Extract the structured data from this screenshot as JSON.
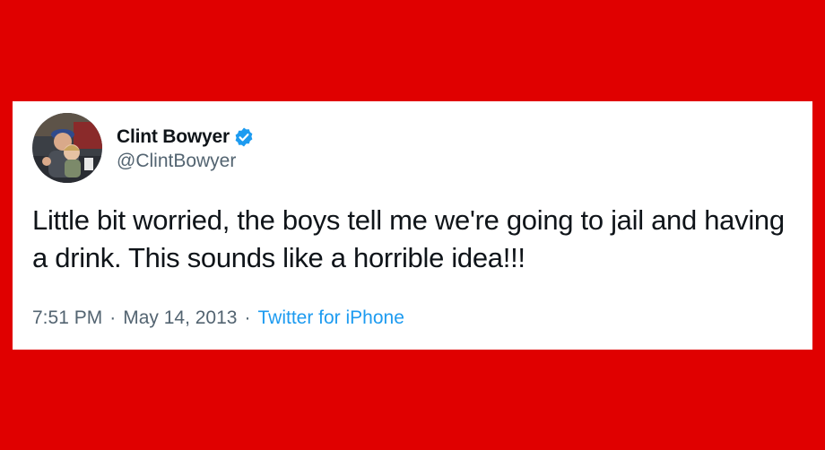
{
  "tweet": {
    "author": {
      "display_name": "Clint Bowyer",
      "handle": "@ClintBowyer",
      "verified": true,
      "avatar_icon": "profile-photo"
    },
    "text": "Little bit worried, the boys tell me we're going to jail and having a drink. This sounds like a horrible idea!!!",
    "time": "7:51 PM",
    "separator": "·",
    "date": "May 14, 2013",
    "source": "Twitter for iPhone"
  },
  "colors": {
    "background": "#e00000",
    "card": "#ffffff",
    "text": "#0f1419",
    "muted": "#536471",
    "link": "#1d9bf0",
    "verified_badge": "#1d9bf0"
  }
}
